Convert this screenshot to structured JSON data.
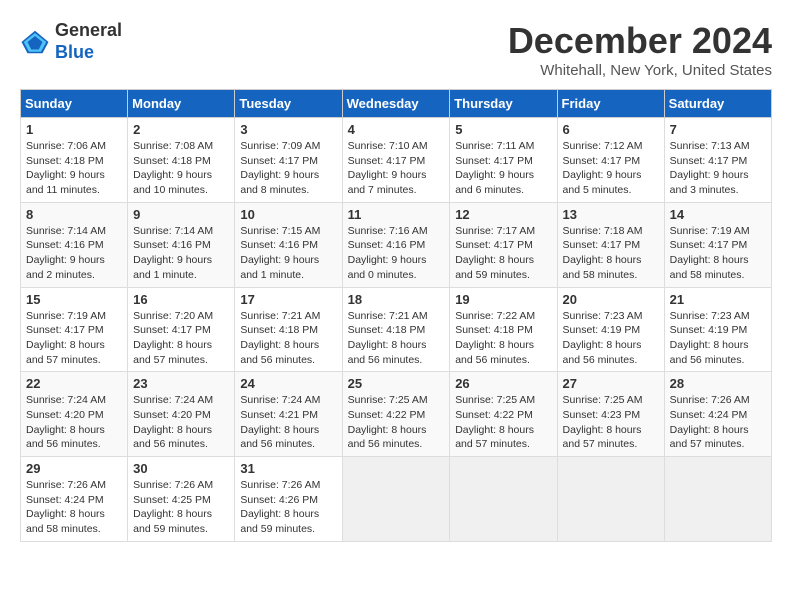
{
  "header": {
    "logo_line1": "General",
    "logo_line2": "Blue",
    "month_title": "December 2024",
    "location": "Whitehall, New York, United States"
  },
  "days_of_week": [
    "Sunday",
    "Monday",
    "Tuesday",
    "Wednesday",
    "Thursday",
    "Friday",
    "Saturday"
  ],
  "weeks": [
    [
      {
        "day": "1",
        "sunrise": "7:06 AM",
        "sunset": "4:18 PM",
        "daylight": "9 hours and 11 minutes."
      },
      {
        "day": "2",
        "sunrise": "7:08 AM",
        "sunset": "4:18 PM",
        "daylight": "9 hours and 10 minutes."
      },
      {
        "day": "3",
        "sunrise": "7:09 AM",
        "sunset": "4:17 PM",
        "daylight": "9 hours and 8 minutes."
      },
      {
        "day": "4",
        "sunrise": "7:10 AM",
        "sunset": "4:17 PM",
        "daylight": "9 hours and 7 minutes."
      },
      {
        "day": "5",
        "sunrise": "7:11 AM",
        "sunset": "4:17 PM",
        "daylight": "9 hours and 6 minutes."
      },
      {
        "day": "6",
        "sunrise": "7:12 AM",
        "sunset": "4:17 PM",
        "daylight": "9 hours and 5 minutes."
      },
      {
        "day": "7",
        "sunrise": "7:13 AM",
        "sunset": "4:17 PM",
        "daylight": "9 hours and 3 minutes."
      }
    ],
    [
      {
        "day": "8",
        "sunrise": "7:14 AM",
        "sunset": "4:16 PM",
        "daylight": "9 hours and 2 minutes."
      },
      {
        "day": "9",
        "sunrise": "7:14 AM",
        "sunset": "4:16 PM",
        "daylight": "9 hours and 1 minute."
      },
      {
        "day": "10",
        "sunrise": "7:15 AM",
        "sunset": "4:16 PM",
        "daylight": "9 hours and 1 minute."
      },
      {
        "day": "11",
        "sunrise": "7:16 AM",
        "sunset": "4:16 PM",
        "daylight": "9 hours and 0 minutes."
      },
      {
        "day": "12",
        "sunrise": "7:17 AM",
        "sunset": "4:17 PM",
        "daylight": "8 hours and 59 minutes."
      },
      {
        "day": "13",
        "sunrise": "7:18 AM",
        "sunset": "4:17 PM",
        "daylight": "8 hours and 58 minutes."
      },
      {
        "day": "14",
        "sunrise": "7:19 AM",
        "sunset": "4:17 PM",
        "daylight": "8 hours and 58 minutes."
      }
    ],
    [
      {
        "day": "15",
        "sunrise": "7:19 AM",
        "sunset": "4:17 PM",
        "daylight": "8 hours and 57 minutes."
      },
      {
        "day": "16",
        "sunrise": "7:20 AM",
        "sunset": "4:17 PM",
        "daylight": "8 hours and 57 minutes."
      },
      {
        "day": "17",
        "sunrise": "7:21 AM",
        "sunset": "4:18 PM",
        "daylight": "8 hours and 56 minutes."
      },
      {
        "day": "18",
        "sunrise": "7:21 AM",
        "sunset": "4:18 PM",
        "daylight": "8 hours and 56 minutes."
      },
      {
        "day": "19",
        "sunrise": "7:22 AM",
        "sunset": "4:18 PM",
        "daylight": "8 hours and 56 minutes."
      },
      {
        "day": "20",
        "sunrise": "7:23 AM",
        "sunset": "4:19 PM",
        "daylight": "8 hours and 56 minutes."
      },
      {
        "day": "21",
        "sunrise": "7:23 AM",
        "sunset": "4:19 PM",
        "daylight": "8 hours and 56 minutes."
      }
    ],
    [
      {
        "day": "22",
        "sunrise": "7:24 AM",
        "sunset": "4:20 PM",
        "daylight": "8 hours and 56 minutes."
      },
      {
        "day": "23",
        "sunrise": "7:24 AM",
        "sunset": "4:20 PM",
        "daylight": "8 hours and 56 minutes."
      },
      {
        "day": "24",
        "sunrise": "7:24 AM",
        "sunset": "4:21 PM",
        "daylight": "8 hours and 56 minutes."
      },
      {
        "day": "25",
        "sunrise": "7:25 AM",
        "sunset": "4:22 PM",
        "daylight": "8 hours and 56 minutes."
      },
      {
        "day": "26",
        "sunrise": "7:25 AM",
        "sunset": "4:22 PM",
        "daylight": "8 hours and 57 minutes."
      },
      {
        "day": "27",
        "sunrise": "7:25 AM",
        "sunset": "4:23 PM",
        "daylight": "8 hours and 57 minutes."
      },
      {
        "day": "28",
        "sunrise": "7:26 AM",
        "sunset": "4:24 PM",
        "daylight": "8 hours and 57 minutes."
      }
    ],
    [
      {
        "day": "29",
        "sunrise": "7:26 AM",
        "sunset": "4:24 PM",
        "daylight": "8 hours and 58 minutes."
      },
      {
        "day": "30",
        "sunrise": "7:26 AM",
        "sunset": "4:25 PM",
        "daylight": "8 hours and 59 minutes."
      },
      {
        "day": "31",
        "sunrise": "7:26 AM",
        "sunset": "4:26 PM",
        "daylight": "8 hours and 59 minutes."
      },
      null,
      null,
      null,
      null
    ]
  ]
}
